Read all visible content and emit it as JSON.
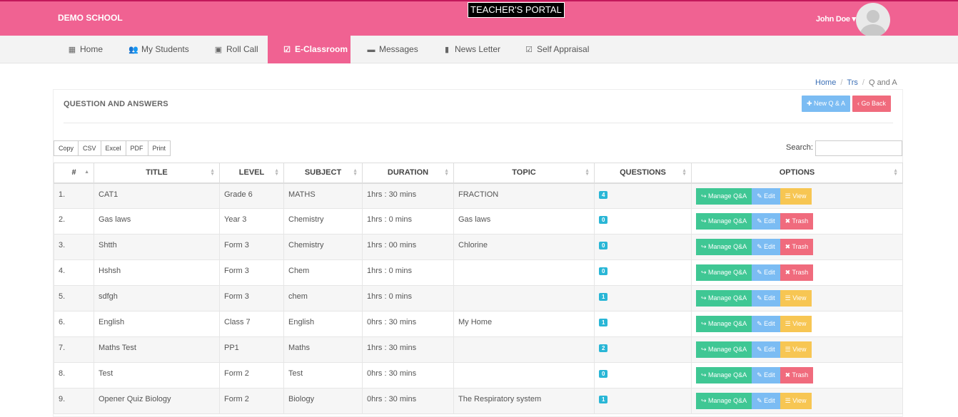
{
  "header": {
    "brand": "DEMO SCHOOL",
    "portal_title": "TEACHER'S PORTAL",
    "user_name": "John Doe ▾"
  },
  "nav": {
    "items": [
      {
        "label": "Home",
        "icon": "dashboard-icon"
      },
      {
        "label": "My Students",
        "icon": "users-icon"
      },
      {
        "label": "Roll Call",
        "icon": "id-card-icon"
      },
      {
        "label": "E-Classroom",
        "icon": "checkbox-icon"
      },
      {
        "label": "Messages",
        "icon": "comment-icon"
      },
      {
        "label": "News Letter",
        "icon": "file-icon"
      },
      {
        "label": "Self Appraisal",
        "icon": "check-square-icon"
      }
    ]
  },
  "breadcrumb": {
    "items": [
      "Home",
      "Trs",
      "Q and A"
    ]
  },
  "panel": {
    "title": "QUESTION AND ANSWERS",
    "new_button": "✚ New Q & A",
    "back_button": "‹ Go Back"
  },
  "export_buttons": [
    "Copy",
    "CSV",
    "Excel",
    "PDF",
    "Print"
  ],
  "search": {
    "label": "Search:",
    "value": ""
  },
  "table": {
    "columns": [
      "#",
      "TITLE",
      "LEVEL",
      "SUBJECT",
      "DURATION",
      "TOPIC",
      "QUESTIONS",
      "OPTIONS"
    ],
    "rows": [
      {
        "num": "1.",
        "title": "CAT1",
        "level": "Grade 6",
        "subject": "MATHS",
        "duration": "1hrs : 30 mins",
        "topic": "FRACTION",
        "questions": "4",
        "third": "view"
      },
      {
        "num": "2.",
        "title": "Gas laws",
        "level": "Year 3",
        "subject": "Chemistry",
        "duration": "1hrs : 0 mins",
        "topic": "Gas laws",
        "questions": "0",
        "third": "trash"
      },
      {
        "num": "3.",
        "title": "Shtth",
        "level": "Form 3",
        "subject": "Chemistry",
        "duration": "1hrs : 00 mins",
        "topic": "Chlorine",
        "questions": "0",
        "third": "trash"
      },
      {
        "num": "4.",
        "title": "Hshsh",
        "level": "Form 3",
        "subject": "Chem",
        "duration": "1hrs : 0 mins",
        "topic": "",
        "questions": "0",
        "third": "trash"
      },
      {
        "num": "5.",
        "title": "sdfgh",
        "level": "Form 3",
        "subject": "chem",
        "duration": "1hrs : 0 mins",
        "topic": "",
        "questions": "1",
        "third": "view"
      },
      {
        "num": "6.",
        "title": "English",
        "level": "Class 7",
        "subject": "English",
        "duration": "0hrs : 30 mins",
        "topic": "My Home",
        "questions": "1",
        "third": "view"
      },
      {
        "num": "7.",
        "title": "Maths Test",
        "level": "PP1",
        "subject": "Maths",
        "duration": "1hrs : 30 mins",
        "topic": "",
        "questions": "2",
        "third": "view"
      },
      {
        "num": "8.",
        "title": "Test",
        "level": "Form 2",
        "subject": "Test",
        "duration": "0hrs : 30 mins",
        "topic": "",
        "questions": "0",
        "third": "trash"
      },
      {
        "num": "9.",
        "title": "Opener Quiz Biology",
        "level": "Form 2",
        "subject": "Biology",
        "duration": "0hrs : 30 mins",
        "topic": "The Respiratory system",
        "questions": "1",
        "third": "view"
      }
    ],
    "option_labels": {
      "manage": "↪ Manage Q&A",
      "edit": "✎ Edit",
      "view": "☰ View",
      "trash": "✖ Trash"
    }
  },
  "colors": {
    "brand_pink": "#f06292",
    "manage_green": "#3fc794",
    "edit_blue": "#7bbcf3",
    "view_yellow": "#f7c653",
    "trash_red": "#f06b7d",
    "badge_cyan": "#29b6d6"
  }
}
